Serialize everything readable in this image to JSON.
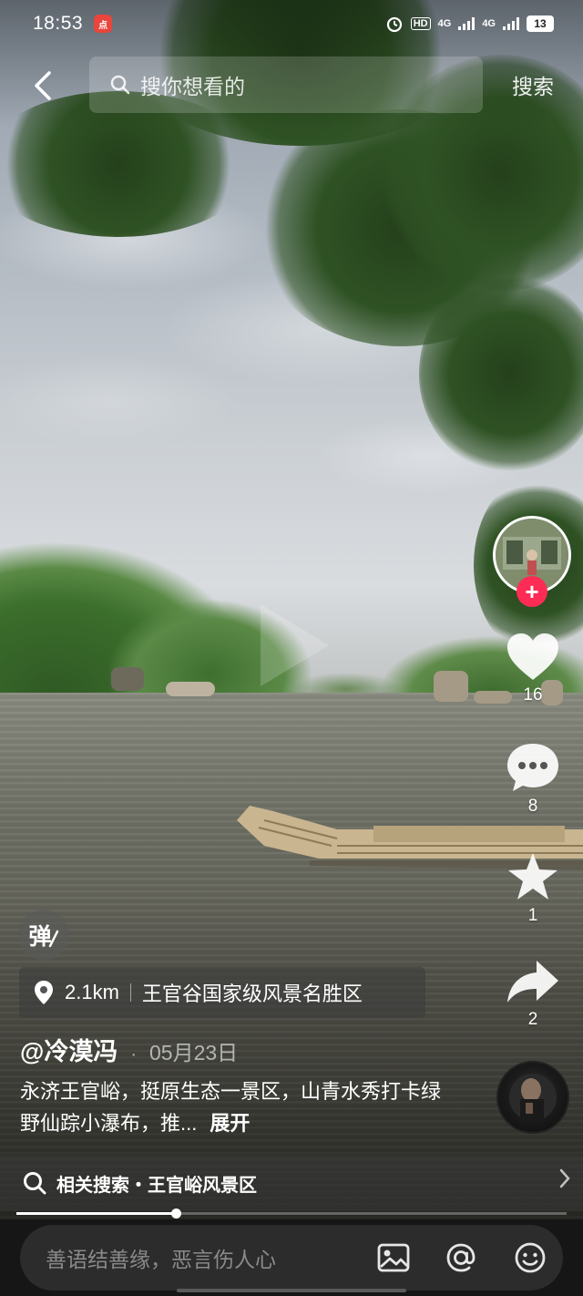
{
  "status_bar": {
    "time": "18:53",
    "app_badge": "点",
    "network_hd": "HD",
    "signal_1": "4G",
    "signal_2": "4G",
    "battery": "13"
  },
  "search": {
    "placeholder": "搜你想看的",
    "button_label": "搜索"
  },
  "actions": {
    "likes": "16",
    "comments": "8",
    "favorites": "1",
    "shares": "2",
    "follow_symbol": "+"
  },
  "danmaku": {
    "label": "弹"
  },
  "location": {
    "distance": "2.1km",
    "place": "王官谷国家级风景名胜区"
  },
  "post": {
    "author": "@冷漠冯",
    "separator": "·",
    "date": "05月23日",
    "description": "永济王官峪，挺原生态一景区，山青水秀打卡绿野仙踪小瀑布，推...",
    "expand_label": "展开"
  },
  "related": {
    "label": "相关搜索・王官峪风景区"
  },
  "progress": {
    "fraction": 0.29
  },
  "comment_bar": {
    "placeholder": "善语结善缘，恶言伤人心"
  },
  "colors": {
    "accent_red": "#fe2c55",
    "comment_bg": "#161616",
    "input_bg": "#2c2c2c"
  }
}
